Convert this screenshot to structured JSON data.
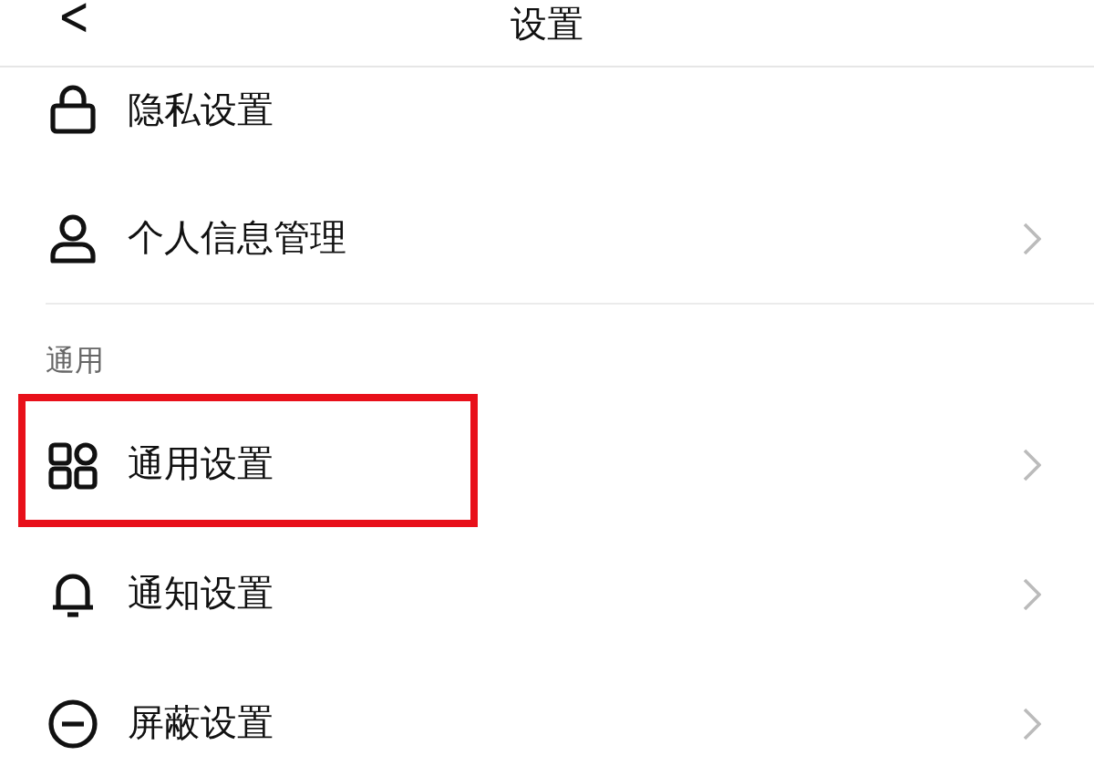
{
  "header": {
    "back": "<",
    "title": "设置"
  },
  "groups": [
    {
      "items": [
        {
          "kind": "lock",
          "label": "隐私设置",
          "chevron": false,
          "highlighted": false
        },
        {
          "kind": "person",
          "label": "个人信息管理",
          "chevron": true,
          "highlighted": false
        }
      ]
    },
    {
      "title": "通用",
      "items": [
        {
          "kind": "grid",
          "label": "通用设置",
          "chevron": true,
          "highlighted": true
        },
        {
          "kind": "bell",
          "label": "通知设置",
          "chevron": true,
          "highlighted": false
        },
        {
          "kind": "minus-circle",
          "label": "屏蔽设置",
          "chevron": true,
          "highlighted": false
        }
      ]
    }
  ]
}
